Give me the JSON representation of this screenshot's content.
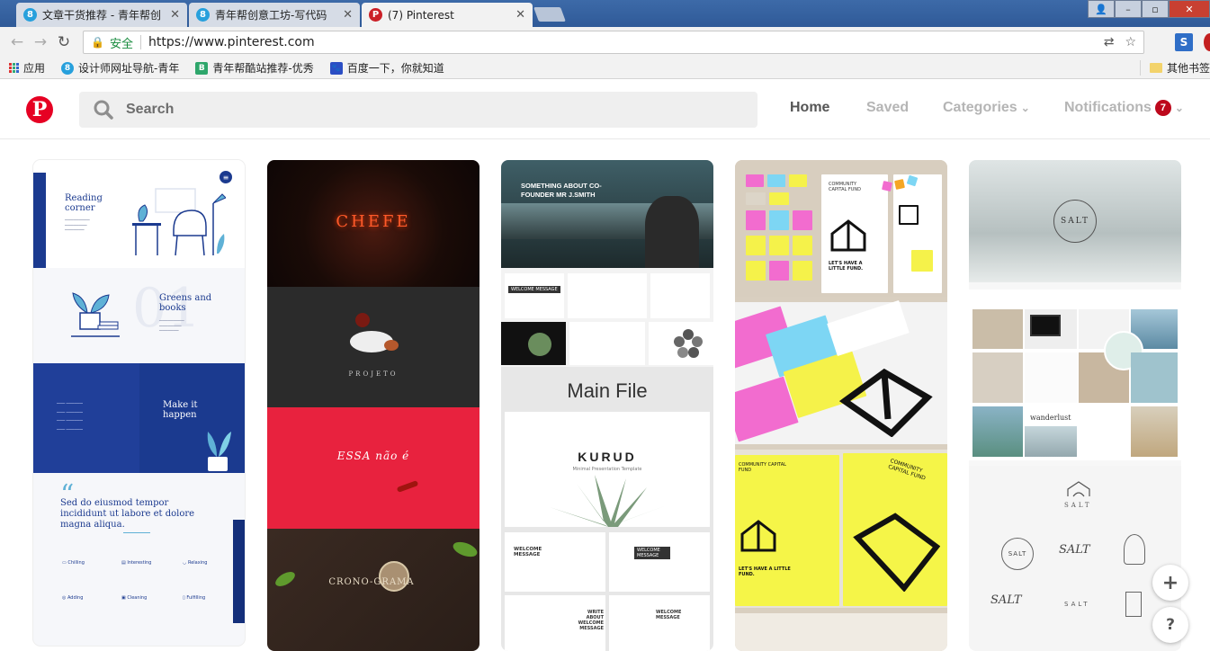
{
  "browser": {
    "tabs": [
      {
        "title": "文章干货推荐 - 青年帮创",
        "icon": "qingnianbang-icon",
        "favicon_glyph": "8"
      },
      {
        "title": "青年帮创意工坊-写代码",
        "icon": "qingnianbang-icon",
        "favicon_glyph": "8"
      },
      {
        "title": "(7) Pinterest",
        "icon": "pinterest-icon",
        "favicon_glyph": "P"
      }
    ],
    "close_glyph": "✕",
    "address": {
      "secure_label": "安全",
      "url": "https://www.pinterest.com"
    },
    "bookmarks": [
      {
        "label": "应用",
        "icon": "apps-icon"
      },
      {
        "label": "设计师网址导航-青年",
        "icon": "qingnianbang-icon",
        "glyph": "8"
      },
      {
        "label": "青年帮酷站推荐-优秀",
        "icon": "bookmark-b-icon",
        "glyph": "B"
      },
      {
        "label": "百度一下，你就知道",
        "icon": "baidu-icon",
        "glyph": "🐾"
      }
    ],
    "other_bookmarks": "其他书签"
  },
  "pinterest": {
    "logo": "P",
    "search_placeholder": "Search",
    "nav": {
      "home": "Home",
      "saved": "Saved",
      "categories": "Categories",
      "notifications": "Notifications",
      "notification_count": "7"
    }
  },
  "pins": {
    "col1": {
      "reading": "Reading corner",
      "greens": "Greens and books",
      "make": "Make it happen",
      "quote": "Sed do eiusmod tempor incididunt ut labore et dolore magna aliqua.",
      "features": [
        "Chilling",
        "Interesting",
        "Relaxing",
        "Adding",
        "Cleaning",
        "Fulfilling"
      ]
    },
    "col2": {
      "chef": "CHEFE",
      "projeto": "PROJETO",
      "essa": "ESSA não é",
      "crono": "CRONO-GRAMA"
    },
    "col3": {
      "hero": "SOMETHING ABOUT CO-FOUNDER MR J.SMITH",
      "welcome": "WELCOME MESSAGE",
      "main_file": "Main File",
      "kurud": "KURUD",
      "kurud_sub": "Minimal Presentation Template",
      "write": "WRITE ABOUT WELCOME MESSAGE"
    },
    "col4": {
      "community": "COMMUNITY CAPITAL FUND",
      "fund": "LET'S HAVE A LITTLE FUND."
    },
    "col5": {
      "salt": "SALT",
      "wanderlust": "wanderlust"
    }
  },
  "floating": {
    "plus": "+",
    "help": "?"
  }
}
